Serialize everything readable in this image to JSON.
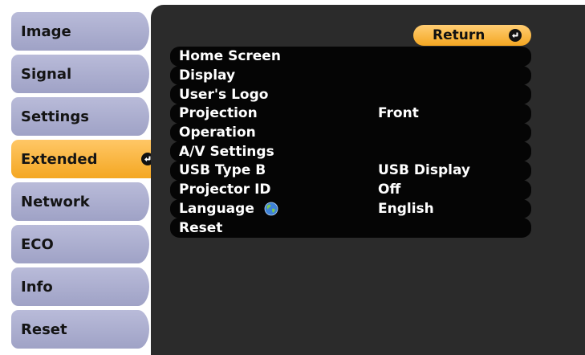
{
  "sidebar": {
    "items": [
      {
        "label": "Image"
      },
      {
        "label": "Signal"
      },
      {
        "label": "Settings"
      },
      {
        "label": "Extended"
      },
      {
        "label": "Network"
      },
      {
        "label": "ECO"
      },
      {
        "label": "Info"
      },
      {
        "label": "Reset"
      }
    ],
    "active_index": 3
  },
  "panel": {
    "return_label": "Return",
    "rows": [
      {
        "label": "Home Screen",
        "value": ""
      },
      {
        "label": "Display",
        "value": ""
      },
      {
        "label": "User's Logo",
        "value": ""
      },
      {
        "label": "Projection",
        "value": "Front"
      },
      {
        "label": "Operation",
        "value": ""
      },
      {
        "label": "A/V Settings",
        "value": ""
      },
      {
        "label": "USB Type B",
        "value": "USB Display"
      },
      {
        "label": "Projector ID",
        "value": "Off"
      },
      {
        "label": "Language",
        "value": "English"
      },
      {
        "label": "Reset",
        "value": ""
      }
    ]
  },
  "colors": {
    "accent": "#f4a722",
    "sidebar_tab": "#abaed0",
    "panel_bg": "#2b2b2b",
    "row_bg": "#050505"
  },
  "icons": {
    "enter": "enter-icon",
    "globe": "globe-icon"
  }
}
